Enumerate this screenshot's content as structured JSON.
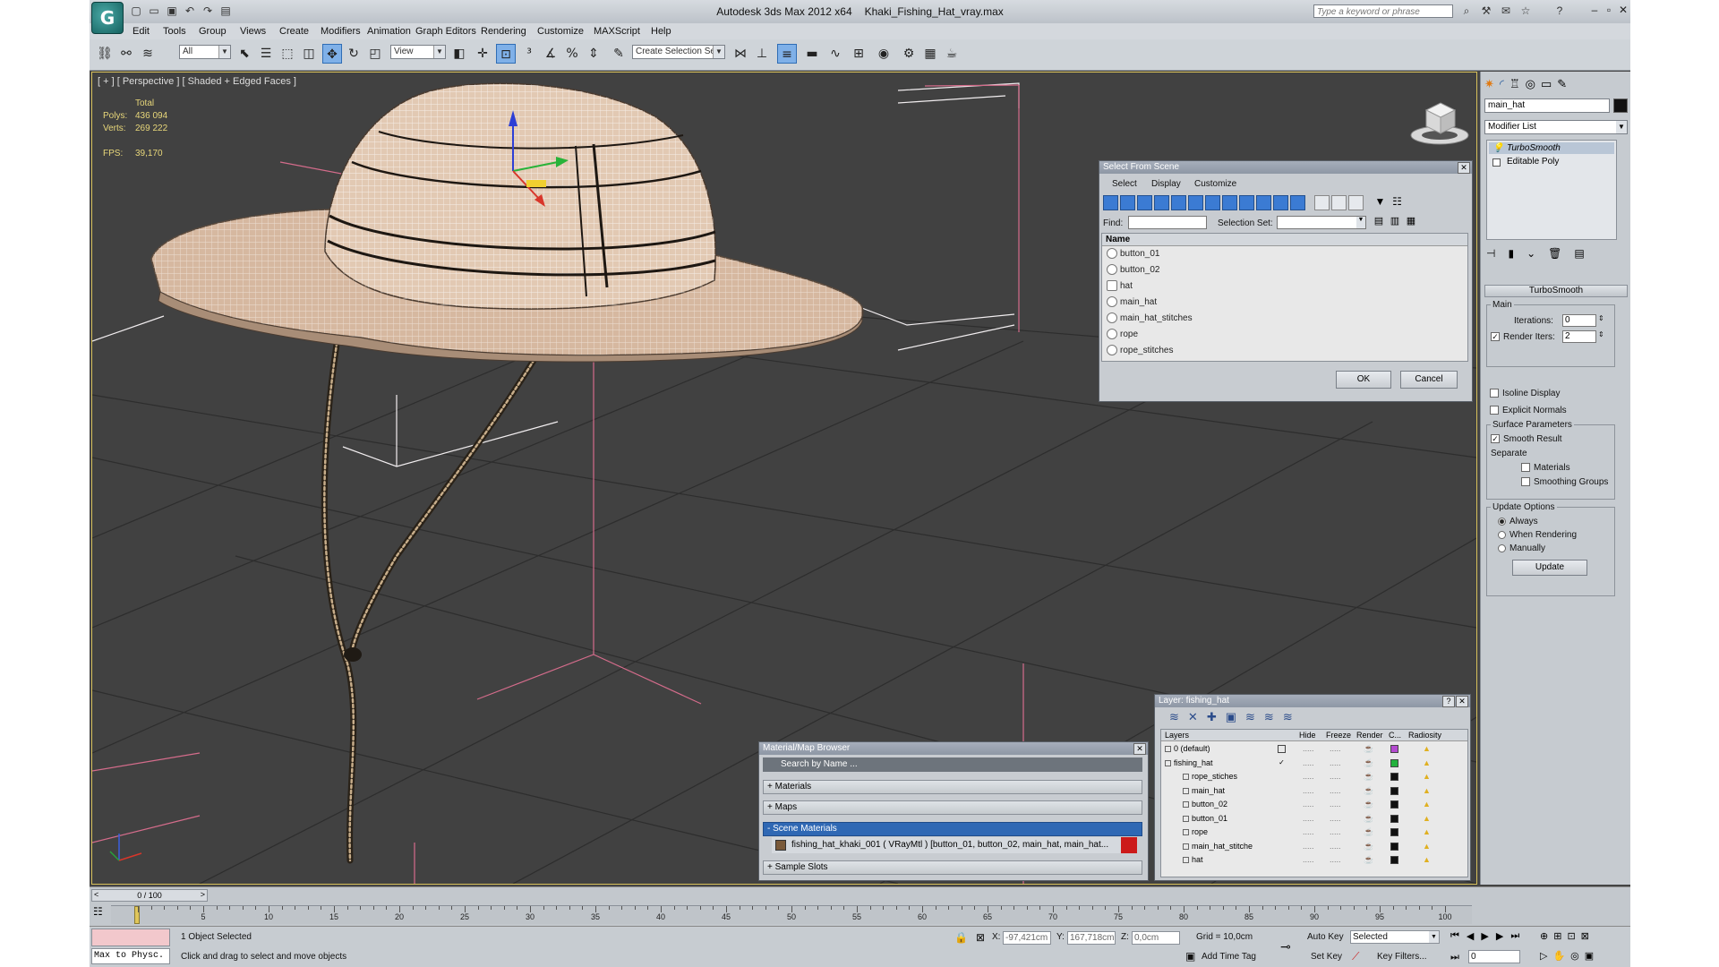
{
  "app": {
    "title": "Autodesk 3ds Max  2012 x64",
    "file": "Khaki_Fishing_Hat_vray.max",
    "search_placeholder": "Type a keyword or phrase"
  },
  "menu": [
    "Edit",
    "Tools",
    "Group",
    "Views",
    "Create",
    "Modifiers",
    "Animation",
    "Graph Editors",
    "Rendering",
    "Customize",
    "MAXScript",
    "Help"
  ],
  "toolbar": {
    "selection_filter": "All",
    "ref_coord": "View",
    "named_selection_set": "Create Selection Se"
  },
  "viewport": {
    "label": "[ + ] [ Perspective ] [ Shaded + Edged Faces ]",
    "stats": {
      "header": "Total",
      "polys_label": "Polys:",
      "polys": "436 094",
      "verts_label": "Verts:",
      "verts": "269 222",
      "fps_label": "FPS:",
      "fps": "39,170"
    }
  },
  "select_from_scene": {
    "title": "Select From Scene",
    "menu": [
      "Select",
      "Display",
      "Customize"
    ],
    "find_label": "Find:",
    "selection_set_label": "Selection Set:",
    "column_name": "Name",
    "items": [
      "button_01",
      "button_02",
      "hat",
      "main_hat",
      "main_hat_stitches",
      "rope",
      "rope_stitches"
    ],
    "ok": "OK",
    "cancel": "Cancel"
  },
  "material_browser": {
    "title": "Material/Map Browser",
    "search": "Search by Name ...",
    "sections": {
      "materials": "+ Materials",
      "maps": "+ Maps",
      "scene": "- Scene Materials",
      "sample": "+ Sample Slots"
    },
    "scene_material": "fishing_hat_khaki_001  ( VRayMtl )  [button_01, button_02, main_hat, main_hat..."
  },
  "layer_dialog": {
    "title": "Layer: fishing_hat",
    "help": "?",
    "columns": [
      "Layers",
      "Hide",
      "Freeze",
      "Render",
      "C...",
      "Radiosity"
    ],
    "layers": [
      {
        "name": "0 (default)",
        "color": "#b44bd0"
      },
      {
        "name": "fishing_hat",
        "color": "#23b13c"
      },
      {
        "name": "rope_stiches",
        "color": "#111111"
      },
      {
        "name": "main_hat",
        "color": "#111111"
      },
      {
        "name": "button_02",
        "color": "#111111"
      },
      {
        "name": "button_01",
        "color": "#111111"
      },
      {
        "name": "rope",
        "color": "#111111"
      },
      {
        "name": "main_hat_stitche",
        "color": "#111111"
      },
      {
        "name": "hat",
        "color": "#111111"
      }
    ],
    "dots": "....."
  },
  "command_panel": {
    "object_name": "main_hat",
    "modifier_list": "Modifier List",
    "stack": [
      "TurboSmooth",
      "Editable Poly"
    ],
    "rollout_title": "TurboSmooth",
    "main_label": "Main",
    "iterations_label": "Iterations:",
    "iterations": "0",
    "render_iters_label": "Render Iters:",
    "render_iters": "2",
    "isoline": "Isoline Display",
    "explicit_normals": "Explicit Normals",
    "surface_params": "Surface Parameters",
    "smooth_result": "Smooth Result",
    "separate": "Separate",
    "materials": "Materials",
    "smoothing_groups": "Smoothing Groups",
    "update_options": "Update Options",
    "always": "Always",
    "when_rendering": "When Rendering",
    "manually": "Manually",
    "update": "Update"
  },
  "timeline": {
    "frame": "0 / 100",
    "ticks": [
      "5",
      "10",
      "15",
      "20",
      "25",
      "30",
      "35",
      "40",
      "45",
      "50",
      "55",
      "60",
      "65",
      "70",
      "75",
      "80",
      "85",
      "90",
      "95",
      "100"
    ]
  },
  "status": {
    "maxscript": "Max to Physc.",
    "selected": "1 Object Selected",
    "prompt": "Click and drag to select and move objects",
    "x_label": "X:",
    "x": "-97,421cm",
    "y_label": "Y:",
    "y": "167,718cm",
    "z_label": "Z:",
    "z": "0,0cm",
    "grid": "Grid = 10,0cm",
    "add_time_tag": "Add Time Tag",
    "auto_key": "Auto Key",
    "set_key": "Set Key",
    "selected_dropdown": "Selected",
    "key_filters": "Key Filters...",
    "frame_field": "0"
  }
}
